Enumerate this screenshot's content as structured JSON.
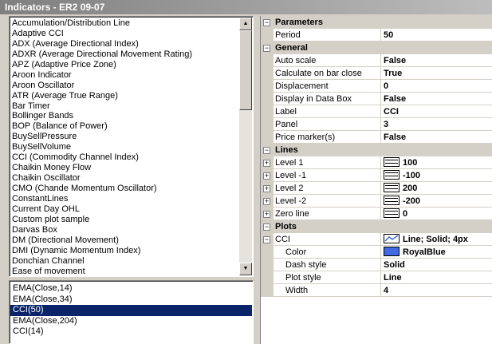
{
  "window": {
    "title": "Indicators - ER2 09-07"
  },
  "indicators": [
    "Accumulation/Distribution Line",
    "Adaptive CCI",
    "ADX (Average Directional Index)",
    "ADXR (Average Directional Movement Rating)",
    "APZ (Adaptive Price Zone)",
    "Aroon Indicator",
    "Aroon Oscillator",
    "ATR (Average True Range)",
    "Bar Timer",
    "Bollinger Bands",
    "BOP (Balance of Power)",
    "BuySellPressure",
    "BuySellVolume",
    "CCI (Commodity Channel Index)",
    "Chaikin Money Flow",
    "Chaikin Oscillator",
    "CMO (Chande Momentum Oscillator)",
    "ConstantLines",
    "Current Day OHL",
    "Custom plot sample",
    "Darvas Box",
    "DM (Directional Movement)",
    "DMI (Dynamic Momentum Index)",
    "Donchian Channel",
    "Ease of movement"
  ],
  "applied": [
    {
      "label": "EMA(Close,14)",
      "selected": false
    },
    {
      "label": "EMA(Close,34)",
      "selected": false
    },
    {
      "label": "CCI(50)",
      "selected": true
    },
    {
      "label": "EMA(Close,204)",
      "selected": false
    },
    {
      "label": "CCI(14)",
      "selected": false
    }
  ],
  "properties": {
    "parameters": {
      "header": "Parameters",
      "expander": "⊟",
      "period": {
        "name": "Period",
        "value": "50"
      }
    },
    "general": {
      "header": "General",
      "expander": "⊟",
      "auto_scale": {
        "name": "Auto scale",
        "value": "False"
      },
      "calc_on_close": {
        "name": "Calculate on bar close",
        "value": "True"
      },
      "displacement": {
        "name": "Displacement",
        "value": "0"
      },
      "display_data_box": {
        "name": "Display in Data Box",
        "value": "False"
      },
      "label": {
        "name": "Label",
        "value": "CCI"
      },
      "panel": {
        "name": "Panel",
        "value": "3"
      },
      "price_markers": {
        "name": "Price marker(s)",
        "value": "False"
      }
    },
    "lines": {
      "header": "Lines",
      "expander": "⊟",
      "level1": {
        "name": "Level 1",
        "value": "100"
      },
      "level_m1": {
        "name": "Level -1",
        "value": "-100"
      },
      "level2": {
        "name": "Level 2",
        "value": "200"
      },
      "level_m2": {
        "name": "Level -2",
        "value": "-200"
      },
      "zero_line": {
        "name": "Zero line",
        "value": "0"
      }
    },
    "plots": {
      "header": "Plots",
      "expander": "⊟",
      "cci": {
        "name": "CCI",
        "value": "Line; Solid; 4px"
      },
      "color": {
        "name": "Color",
        "value": "RoyalBlue",
        "hex": "#4169e1"
      },
      "dash_style": {
        "name": "Dash style",
        "value": "Solid"
      },
      "plot_style": {
        "name": "Plot style",
        "value": "Line"
      },
      "width": {
        "name": "Width",
        "value": "4"
      }
    },
    "expand_symbol": "+",
    "collapse_symbol": "−"
  },
  "icons": {
    "scroll_up": "▲",
    "scroll_down": "▼"
  },
  "colors": {
    "selection": "#0a246a",
    "royal_blue": "#4169e1"
  }
}
